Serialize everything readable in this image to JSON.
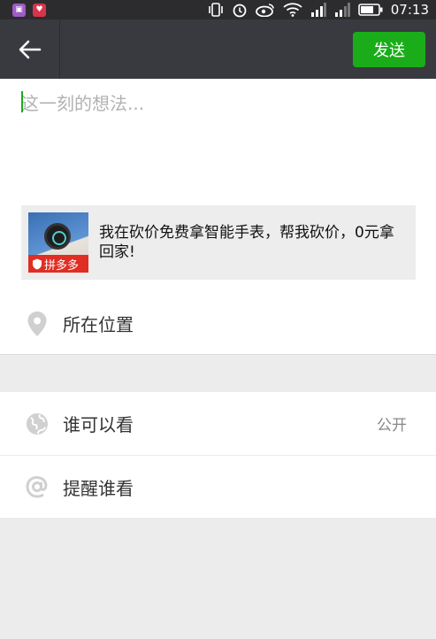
{
  "status_bar": {
    "time": "07:13",
    "icons": [
      "app-badge-purple",
      "app-badge-red",
      "vibrate-icon",
      "alarm-icon",
      "weibo-icon",
      "wifi-icon",
      "signal-icon",
      "signal-icon-2",
      "battery-icon"
    ]
  },
  "title_bar": {
    "send_label": "发送"
  },
  "composer": {
    "placeholder": "这一刻的想法..."
  },
  "share_card": {
    "tag": "拼多多",
    "text": "我在砍价免费拿智能手表，帮我砍价，0元拿回家!"
  },
  "location": {
    "label": "所在位置"
  },
  "options": {
    "visibility_label": "谁可以看",
    "visibility_value": "公开",
    "remind_label": "提醒谁看"
  },
  "colors": {
    "accent": "#1aad19",
    "title_bar": "#393a3f",
    "background": "#ebeceb"
  }
}
